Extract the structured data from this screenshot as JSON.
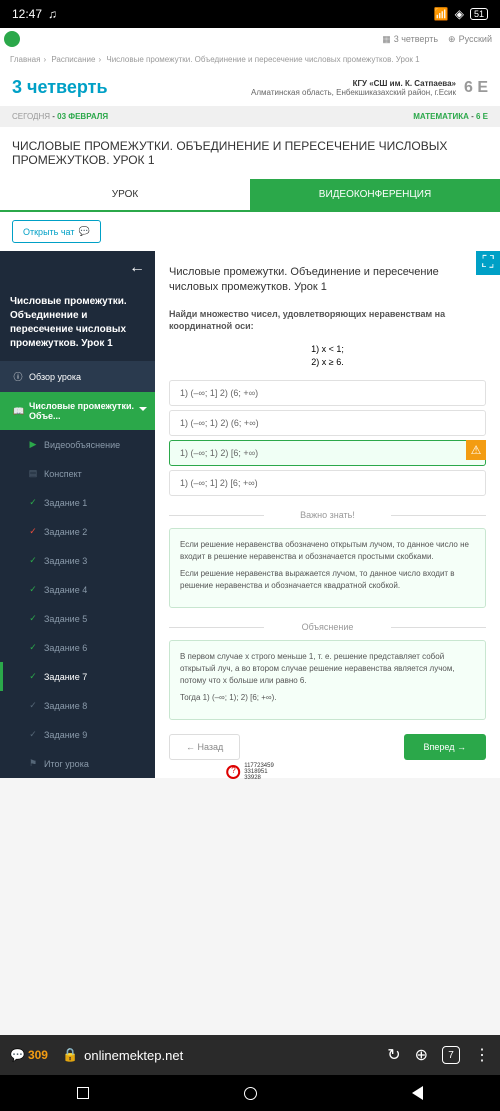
{
  "statusbar": {
    "time": "12:47",
    "battery": "51"
  },
  "topbar": {
    "quarter": "3 четверть",
    "lang": "Русский"
  },
  "breadcrumb": {
    "home": "Главная",
    "schedule": "Расписание",
    "lesson": "Числовые промежутки. Объединение и пересечение числовых промежутков. Урок 1"
  },
  "quarter": {
    "title": "3 четверть",
    "school": "КГУ «СШ им. К. Сатпаева»",
    "region": "Алматинская область, Енбекшиказахский район, г.Есик",
    "class": "6 Е"
  },
  "datebar": {
    "today": "СЕГОДНЯ",
    "date": "03 ФЕВРАЛЯ",
    "subject": "МАТЕМАТИКА",
    "grade": "6 Е"
  },
  "lesson_title": "ЧИСЛОВЫЕ ПРОМЕЖУТКИ. ОБЪЕДИНЕНИЕ И ПЕРЕСЕЧЕНИЕ ЧИСЛОВЫХ ПРОМЕЖУТКОВ. УРОК 1",
  "tabs": {
    "lesson": "УРОК",
    "video": "ВИДЕОКОНФЕРЕНЦИЯ"
  },
  "chat_btn": "Открыть чат",
  "sidebar": {
    "title": "Числовые промежутки. Объединение и пересечение числовых промежутков. Урок 1",
    "overview": "Обзор урока",
    "topic": "Числовые промежутки. Объе...",
    "items": [
      "Видеообъяснение",
      "Конспект",
      "Задание 1",
      "Задание 2",
      "Задание 3",
      "Задание 4",
      "Задание 5",
      "Задание 6",
      "Задание 7",
      "Задание 8",
      "Задание 9",
      "Итог урока"
    ]
  },
  "content": {
    "title": "Числовые промежутки. Объединение и пересечение числовых промежутков. Урок 1",
    "task": "Найди множество чисел, удовлетворяющих неравенствам на координатной оси:",
    "cond1": "1) x < 1;",
    "cond2": "2) x ≥ 6.",
    "options": [
      "1) (–∞; 1] 2) (6; +∞)",
      "1) (–∞; 1) 2) (6; +∞)",
      "1) (–∞; 1) 2) [6; +∞)",
      "1) (–∞; 1] 2) [6; +∞)"
    ],
    "important_label": "Важно знать!",
    "important_text1": "Если решение неравенства обозначено открытым лучом, то данное число не входит в решение неравенства и обозначается простыми скобками.",
    "important_text2": "Если решение неравенства выражается лучом, то данное число входит в решение неравенства и обозначается квадратной скобкой.",
    "explain_label": "Объяснение",
    "explain_text1": "В первом случае x строго меньше 1, т. е. решение представляет собой открытый луч, а во втором случае решение неравенства является лучом, потому что x больше или равно 6.",
    "explain_text2": "Тогда 1) (–∞; 1); 2) [6; +∞).",
    "back": "Назад",
    "next": "Вперед"
  },
  "qbadge": {
    "l1": "117723459",
    "l2": "3318951",
    "l3": "33928"
  },
  "browser": {
    "count": "309",
    "url": "onlinemektep.net",
    "tabs": "7"
  }
}
